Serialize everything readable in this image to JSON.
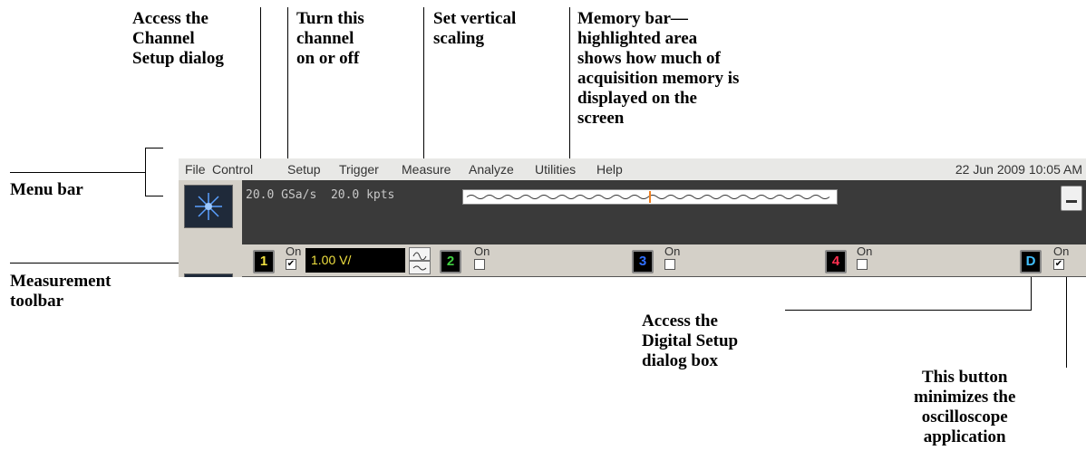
{
  "captions": {
    "channel_setup": "Access the\nChannel\nSetup dialog",
    "turn_channel": "Turn this\nchannel\non or off",
    "vertical_scaling": "Set vertical\nscaling",
    "memory_bar": "Memory bar—\nhighlighted area\nshows how much of\nacquisition memory is\ndisplayed on the\nscreen",
    "menu_bar": "Menu bar",
    "measurement_toolbar": "Measurement\ntoolbar",
    "digital_setup": "Access the\nDigital Setup\ndialog box",
    "minimize": "This button\nminimizes the\noscilloscope\napplication"
  },
  "menu": {
    "items": [
      "File",
      "Control",
      "Setup",
      "Trigger",
      "Measure",
      "Analyze",
      "Utilities",
      "Help"
    ],
    "datetime": "22 Jun 2009 10:05 AM"
  },
  "status": {
    "sample_rate": "20.0 GSa/s",
    "memory_depth": "20.0 kpts"
  },
  "channels": {
    "ch1": {
      "label": "1",
      "on_label": "On",
      "checked": "✔",
      "scale": "1.00 V/",
      "color": "#f0e040"
    },
    "ch2": {
      "label": "2",
      "on_label": "On",
      "color": "#40d040"
    },
    "ch3": {
      "label": "3",
      "on_label": "On",
      "color": "#3070ff"
    },
    "ch4": {
      "label": "4",
      "on_label": "On",
      "color": "#ff3050"
    },
    "digital": {
      "label": "D",
      "on_label": "On",
      "checked": "✔",
      "color": "#40c0ff"
    }
  },
  "vertical_scaling_icons": [
    "sine-up-icon",
    "sine-down-icon"
  ],
  "colors": {
    "memory_highlight": "#f08020",
    "menubar_bg": "#e8e8e6"
  }
}
